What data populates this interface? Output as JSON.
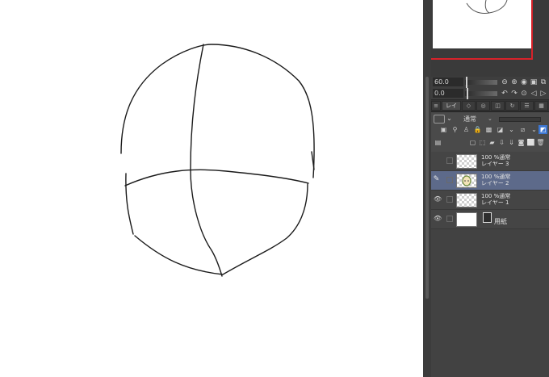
{
  "controls": {
    "zoom_value": "60.0",
    "rotate_value": "0.0"
  },
  "layer_panel": {
    "tab_label": "レイ",
    "blend_mode": "通常",
    "layers": [
      {
        "properties": "100 %通常",
        "name": "レイヤー 3",
        "visible": false,
        "selected": false
      },
      {
        "properties": "100 %通常",
        "name": "レイヤー 2",
        "visible": false,
        "selected": true,
        "editing": true
      },
      {
        "properties": "100 %通常",
        "name": "レイヤー 1",
        "visible": true,
        "selected": false
      },
      {
        "properties": "",
        "name": "用紙",
        "visible": true,
        "selected": false,
        "paper": true
      }
    ]
  },
  "icons": {
    "eye": "eye-icon",
    "pen": "pen-icon",
    "paper": "paper-icon"
  },
  "colors": {
    "selection": "#5d6a8a",
    "navigator_frame": "#d8222a",
    "panel_bg": "#4a4a4a"
  }
}
